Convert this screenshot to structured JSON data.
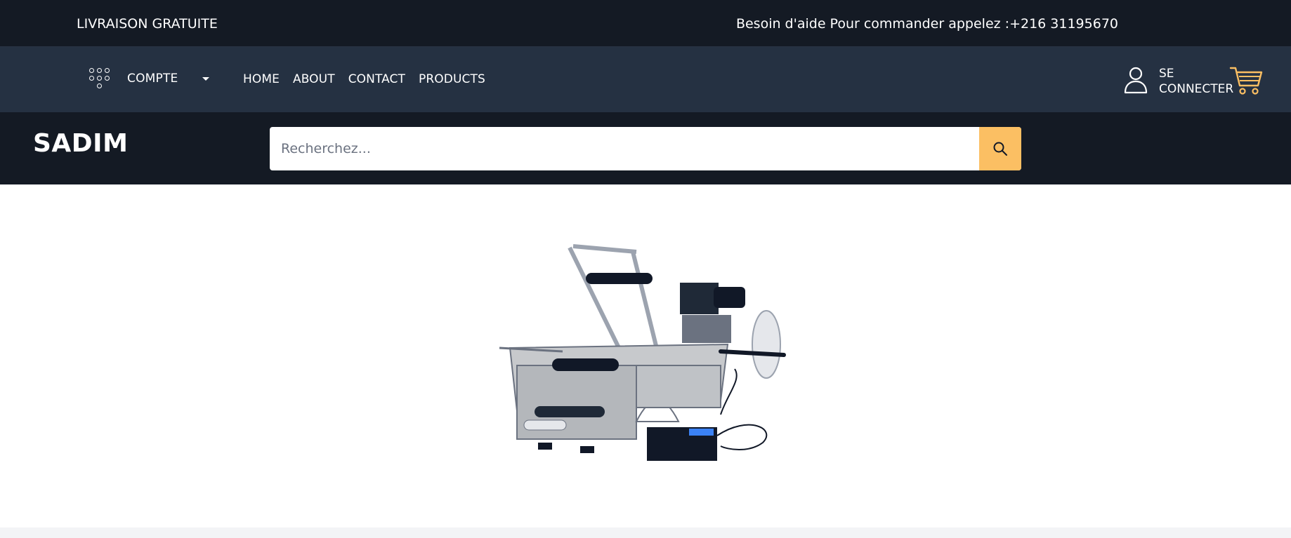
{
  "topbar": {
    "left_text": "LIVRAISON GRATUITE",
    "right_text": "Besoin d'aide Pour commander appelez :+216 31195670"
  },
  "navbar": {
    "account_label": "COMPTE",
    "account_icon": "dots-grid-icon",
    "menu": [
      {
        "label": "HOME"
      },
      {
        "label": "ABOUT"
      },
      {
        "label": "CONTACT"
      },
      {
        "label": "PRODUCTS"
      }
    ],
    "login_line1": "SE",
    "login_line2": "CONNECTER",
    "user_icon": "user-icon",
    "cart_icon": "cart-icon"
  },
  "header": {
    "logo": "SADIM",
    "search": {
      "placeholder": "Recherchez...",
      "button_icon": "search-icon"
    }
  },
  "colors": {
    "topbar_bg": "#141a24",
    "navbar_bg": "#253142",
    "accent": "#fbbf63",
    "cart_accent": "#fbbf63"
  },
  "main": {
    "product_image": "labeling-machine-image"
  }
}
